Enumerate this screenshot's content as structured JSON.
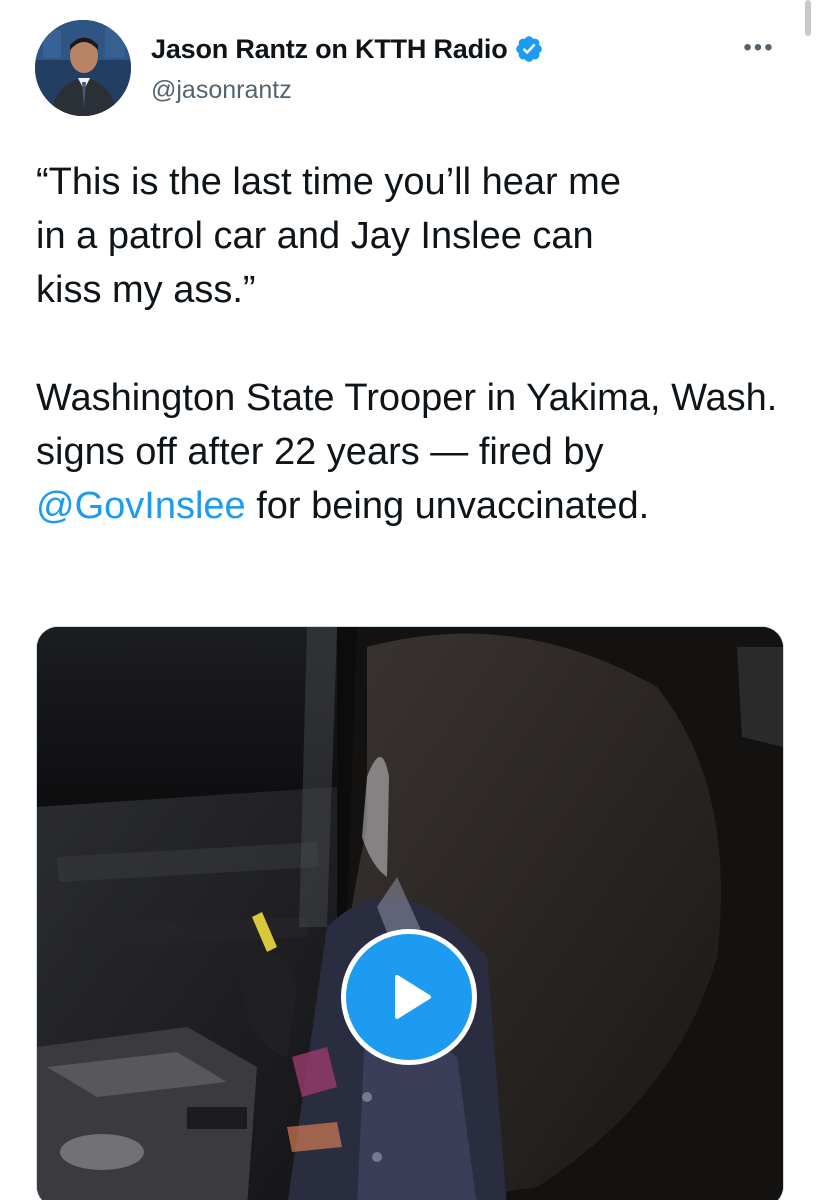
{
  "author": {
    "display_name": "Jason Rantz on KTTH Radio",
    "handle": "@jasonrantz",
    "verified": true
  },
  "tweet": {
    "quote_lines": [
      "“This is the last time you’ll hear me",
      "in a patrol car and Jay Inslee can",
      "kiss my ass.”"
    ],
    "body_before_mention": "Washington State Trooper in Yakima, Wash. signs off after 22 years — fired by ",
    "mention": "@GovInslee",
    "body_after_mention": " for being unvaccinated."
  },
  "media": {
    "type": "video",
    "play_icon": "play-icon"
  },
  "icons": {
    "more": "more-options-icon",
    "verified": "verified-badge-icon"
  },
  "colors": {
    "accent": "#1d9bf0",
    "text_primary": "#0f1419",
    "text_secondary": "#536471"
  }
}
